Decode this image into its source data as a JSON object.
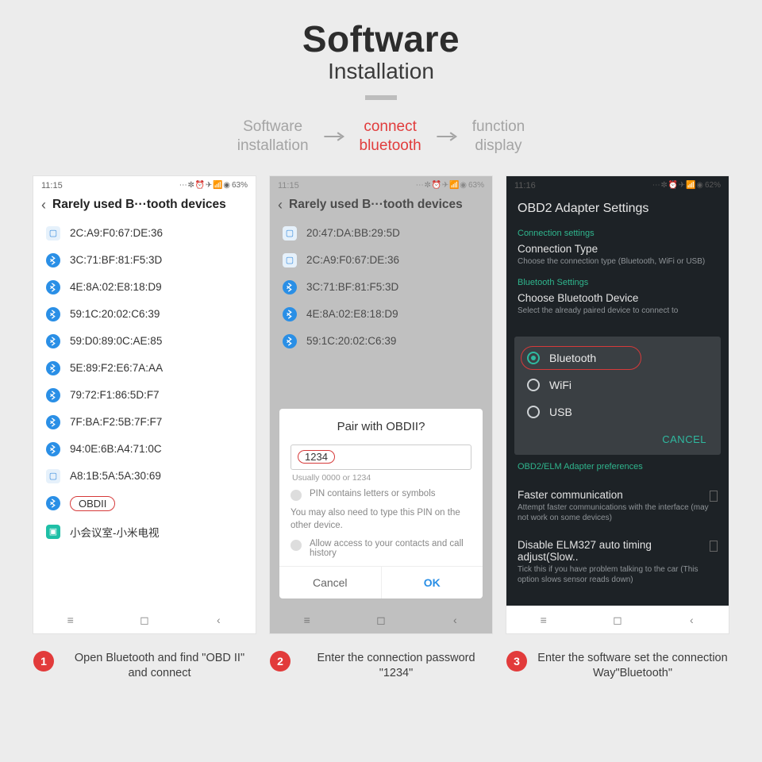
{
  "header": {
    "title": "Software",
    "subtitle": "Installation"
  },
  "breadcrumb": {
    "step1_l1": "Software",
    "step1_l2": "installation",
    "step2_l1": "connect",
    "step2_l2": "bluetooth",
    "step3_l1": "function",
    "step3_l2": "display"
  },
  "phone1": {
    "time": "11:15",
    "battery": "63%",
    "nav_title": "Rarely used B···tooth devices",
    "devices": [
      {
        "name": "2C:A9:F0:67:DE:36",
        "icon": "sq"
      },
      {
        "name": "3C:71:BF:81:F5:3D",
        "icon": "bt"
      },
      {
        "name": "4E:8A:02:E8:18:D9",
        "icon": "bt"
      },
      {
        "name": "59:1C:20:02:C6:39",
        "icon": "bt"
      },
      {
        "name": "59:D0:89:0C:AE:85",
        "icon": "bt"
      },
      {
        "name": "5E:89:F2:E6:7A:AA",
        "icon": "bt"
      },
      {
        "name": "79:72:F1:86:5D:F7",
        "icon": "bt"
      },
      {
        "name": "7F:BA:F2:5B:7F:F7",
        "icon": "bt"
      },
      {
        "name": "94:0E:6B:A4:71:0C",
        "icon": "bt"
      },
      {
        "name": "A8:1B:5A:5A:30:69",
        "icon": "sq"
      },
      {
        "name": "OBDII",
        "icon": "bt",
        "highlight": true
      },
      {
        "name": "小会议室-小米电视",
        "icon": "teal"
      }
    ]
  },
  "phone2": {
    "time": "11:15",
    "battery": "63%",
    "nav_title": "Rarely used B···tooth devices",
    "devices": [
      {
        "name": "20:47:DA:BB:29:5D",
        "icon": "sq"
      },
      {
        "name": "2C:A9:F0:67:DE:36",
        "icon": "sq"
      },
      {
        "name": "3C:71:BF:81:F5:3D",
        "icon": "bt"
      },
      {
        "name": "4E:8A:02:E8:18:D9",
        "icon": "bt"
      },
      {
        "name": "59:1C:20:02:C6:39",
        "icon": "bt"
      }
    ],
    "dialog": {
      "title": "Pair with OBDII?",
      "pin": "1234",
      "hint": "Usually 0000 or 1234",
      "opt1": "PIN contains letters or symbols",
      "info": "You may also need to type this PIN on the other device.",
      "opt2": "Allow access to your contacts and call history",
      "cancel": "Cancel",
      "ok": "OK"
    }
  },
  "phone3": {
    "time": "11:16",
    "battery": "62%",
    "title": "OBD2 Adapter Settings",
    "sec_conn": "Connection settings",
    "conn_type": "Connection Type",
    "conn_type_sub": "Choose the connection type (Bluetooth, WiFi or USB)",
    "sec_bt": "Bluetooth Settings",
    "choose_bt": "Choose Bluetooth Device",
    "choose_bt_sub": "Select the already paired device to connect to",
    "options": {
      "o1": "Bluetooth",
      "o2": "WiFi",
      "o3": "USB",
      "cancel": "CANCEL"
    },
    "sec_pref": "OBD2/ELM Adapter preferences",
    "fast": "Faster communication",
    "fast_sub": "Attempt faster communications with the interface (may not work on some devices)",
    "disable": "Disable ELM327 auto timing adjust(Slow..",
    "disable_sub": "Tick this if you have problem talking to the car (This option slows sensor reads down)"
  },
  "captions": {
    "n1": "1",
    "t1": "Open Bluetooth and find \"OBD II\" and connect",
    "n2": "2",
    "t2": "Enter the connection password \"1234\"",
    "n3": "3",
    "t3": "Enter the software set the connection Way\"Bluetooth\""
  }
}
